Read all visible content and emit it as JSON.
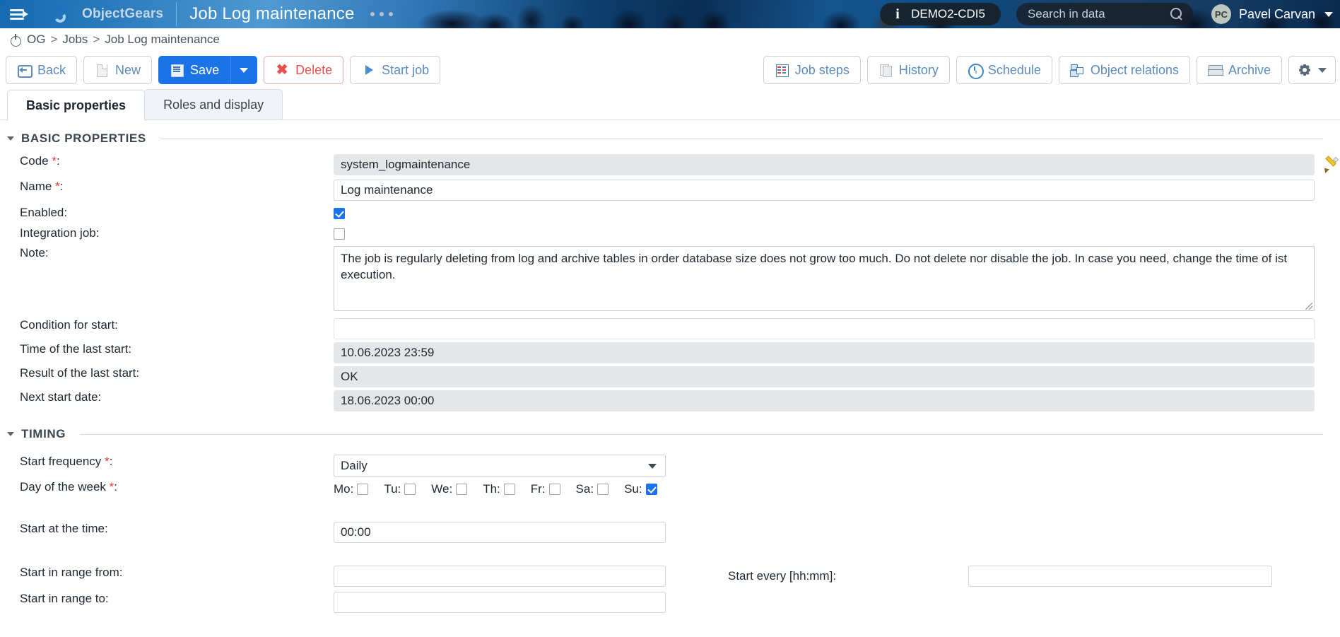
{
  "header": {
    "menu_icon": "hamburger-menu-icon",
    "brand": "ObjectGears",
    "page_title": "Job Log maintenance",
    "overflow_dots": "…",
    "environment": "DEMO2-CDI5",
    "environment_info_icon": "info-icon",
    "search_placeholder": "Search in data",
    "search_value": "",
    "search_icon": "search-icon",
    "user_initials": "PC",
    "user_name": "Pavel Carvan",
    "user_chevron": "chevron-down-icon"
  },
  "breadcrumb": {
    "home_icon": "power-icon",
    "items": [
      "OG",
      "Jobs",
      "Job Log maintenance"
    ],
    "separator": ">"
  },
  "toolbar": {
    "left": [
      {
        "label": "Back",
        "icon": "back-icon",
        "style": "default"
      },
      {
        "label": "New",
        "icon": "new-document-icon",
        "style": "default"
      },
      {
        "label": "Save",
        "icon": "save-disk-icon",
        "style": "primary"
      },
      {
        "label": "",
        "icon": "chevron-down-icon",
        "style": "primary-caret"
      },
      {
        "label": "Delete",
        "icon": "delete-x-icon",
        "style": "danger"
      },
      {
        "label": "Start job",
        "icon": "play-icon",
        "style": "default"
      }
    ],
    "right": [
      {
        "label": "Job steps",
        "icon": "job-steps-icon"
      },
      {
        "label": "History",
        "icon": "history-icon"
      },
      {
        "label": "Schedule",
        "icon": "clock-icon"
      },
      {
        "label": "Object relations",
        "icon": "object-relations-icon"
      },
      {
        "label": "Archive",
        "icon": "archive-icon"
      },
      {
        "label": "",
        "icon": "gear-icon"
      }
    ]
  },
  "tabs": [
    {
      "label": "Basic properties",
      "active": true
    },
    {
      "label": "Roles and display",
      "active": false
    }
  ],
  "sections": {
    "basic": {
      "title": "BASIC PROPERTIES",
      "fields": {
        "code_label": "Code",
        "code_value": "system_logmaintenance",
        "code_edit_icon": "pencil-icon",
        "name_label": "Name",
        "name_value": "Log maintenance",
        "enabled_label": "Enabled:",
        "enabled_checked": true,
        "integration_label": "Integration job:",
        "integration_checked": false,
        "note_label": "Note:",
        "note_value": "The job is regularly deleting from log and archive tables in order database size does not grow too much. Do not delete nor disable the job. In case you need, change the time of ist execution.",
        "condition_label": "Condition for start:",
        "condition_value": "",
        "last_start_label": "Time of the last start:",
        "last_start_value": "10.06.2023 23:59",
        "last_result_label": "Result of the last start:",
        "last_result_value": "OK",
        "next_start_label": "Next start date:",
        "next_start_value": "18.06.2023 00:00"
      }
    },
    "timing": {
      "title": "TIMING",
      "fields": {
        "frequency_label": "Start frequency",
        "frequency_value": "Daily",
        "frequency_options": [
          "Daily"
        ],
        "dow_label": "Day of the week",
        "days": [
          {
            "label": "Mo:",
            "checked": false
          },
          {
            "label": "Tu:",
            "checked": false
          },
          {
            "label": "We:",
            "checked": false
          },
          {
            "label": "Th:",
            "checked": false
          },
          {
            "label": "Fr:",
            "checked": false
          },
          {
            "label": "Sa:",
            "checked": false
          },
          {
            "label": "Su:",
            "checked": true
          }
        ],
        "start_time_label": "Start at the time:",
        "start_time_value": "00:00",
        "range_from_label": "Start in range from:",
        "range_from_value": "",
        "range_to_label": "Start in range to:",
        "range_to_value": "",
        "every_label": "Start every [hh:mm]:",
        "every_value": ""
      }
    }
  },
  "required_marker": "*",
  "colors": {
    "primary": "#1a73e8",
    "danger": "#ea4f4f",
    "link": "#5b8bbd",
    "readonly_bg": "#e4e6e8"
  }
}
